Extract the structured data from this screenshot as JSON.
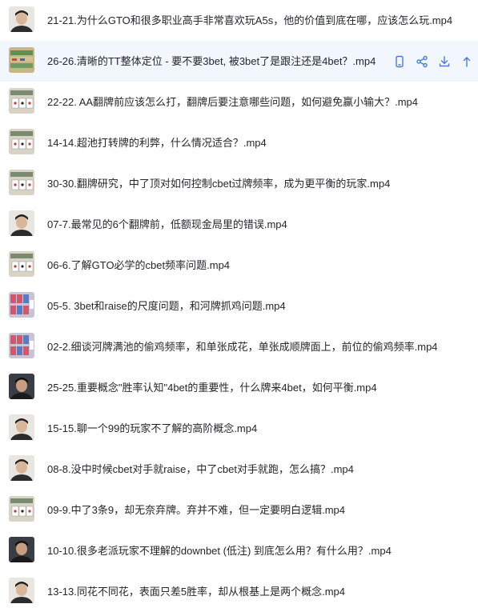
{
  "files": [
    {
      "name": "21-21.为什么GTO和很多职业高手非常喜欢玩A5s，他的价值到底在哪，应该怎么玩.mp4",
      "thumb": "person"
    },
    {
      "name": "26-26.清晰的TT整体定位 - 要不要3bet, 被3bet了是跟注还是4bet？.mp4",
      "thumb": "table"
    },
    {
      "name": "22-22. AA翻牌前应该怎么打，翻牌后要注意哪些问题，如何避免赢小输大？.mp4",
      "thumb": "cards"
    },
    {
      "name": "14-14.超池打转牌的利弊，什么情况适合？.mp4",
      "thumb": "cards"
    },
    {
      "name": "30-30.翻牌研究，中了顶对如何控制cbet过牌频率，成为更平衡的玩家.mp4",
      "thumb": "cards"
    },
    {
      "name": "07-7.最常见的6个翻牌前，低额现金局里的错误.mp4",
      "thumb": "person"
    },
    {
      "name": "06-6.了解GTO必学的cbet频率问题.mp4",
      "thumb": "cards"
    },
    {
      "name": "05-5. 3bet和raise的尺度问题，和河牌抓鸡问题.mp4",
      "thumb": "redcards"
    },
    {
      "name": "02-2.细谈河牌满池的偷鸡频率，和单张成花，单张成顺牌面上，前位的偷鸡频率.mp4",
      "thumb": "redcards"
    },
    {
      "name": "25-25.重要概念\"胜率认知\"4bet的重要性，什么牌来4bet，如何平衡.mp4",
      "thumb": "person-dark"
    },
    {
      "name": "15-15.聊一个99的玩家不了解的高阶概念.mp4",
      "thumb": "person"
    },
    {
      "name": "08-8.没中时候cbet对手就raise，中了cbet对手就跑，怎么搞？.mp4",
      "thumb": "person"
    },
    {
      "name": "09-9.中了3条9，却无奈弃牌。弃并不难，但一定要明白逻辑.mp4",
      "thumb": "cards"
    },
    {
      "name": "10-10.很多老派玩家不理解的downbet (低注) 到底怎么用？有什么用？.mp4",
      "thumb": "person-dark"
    },
    {
      "name": "13-13.同花不同花，表面只差5胜率，却从根基上是两个概念.mp4",
      "thumb": "person"
    }
  ],
  "hover_row": 1,
  "actions": [
    "phone-icon",
    "share-icon",
    "download-icon",
    "more-icon"
  ],
  "colors": {
    "hover_bg": "#f2f6fd",
    "icon": "#4a7bd6",
    "text": "#25262b"
  }
}
